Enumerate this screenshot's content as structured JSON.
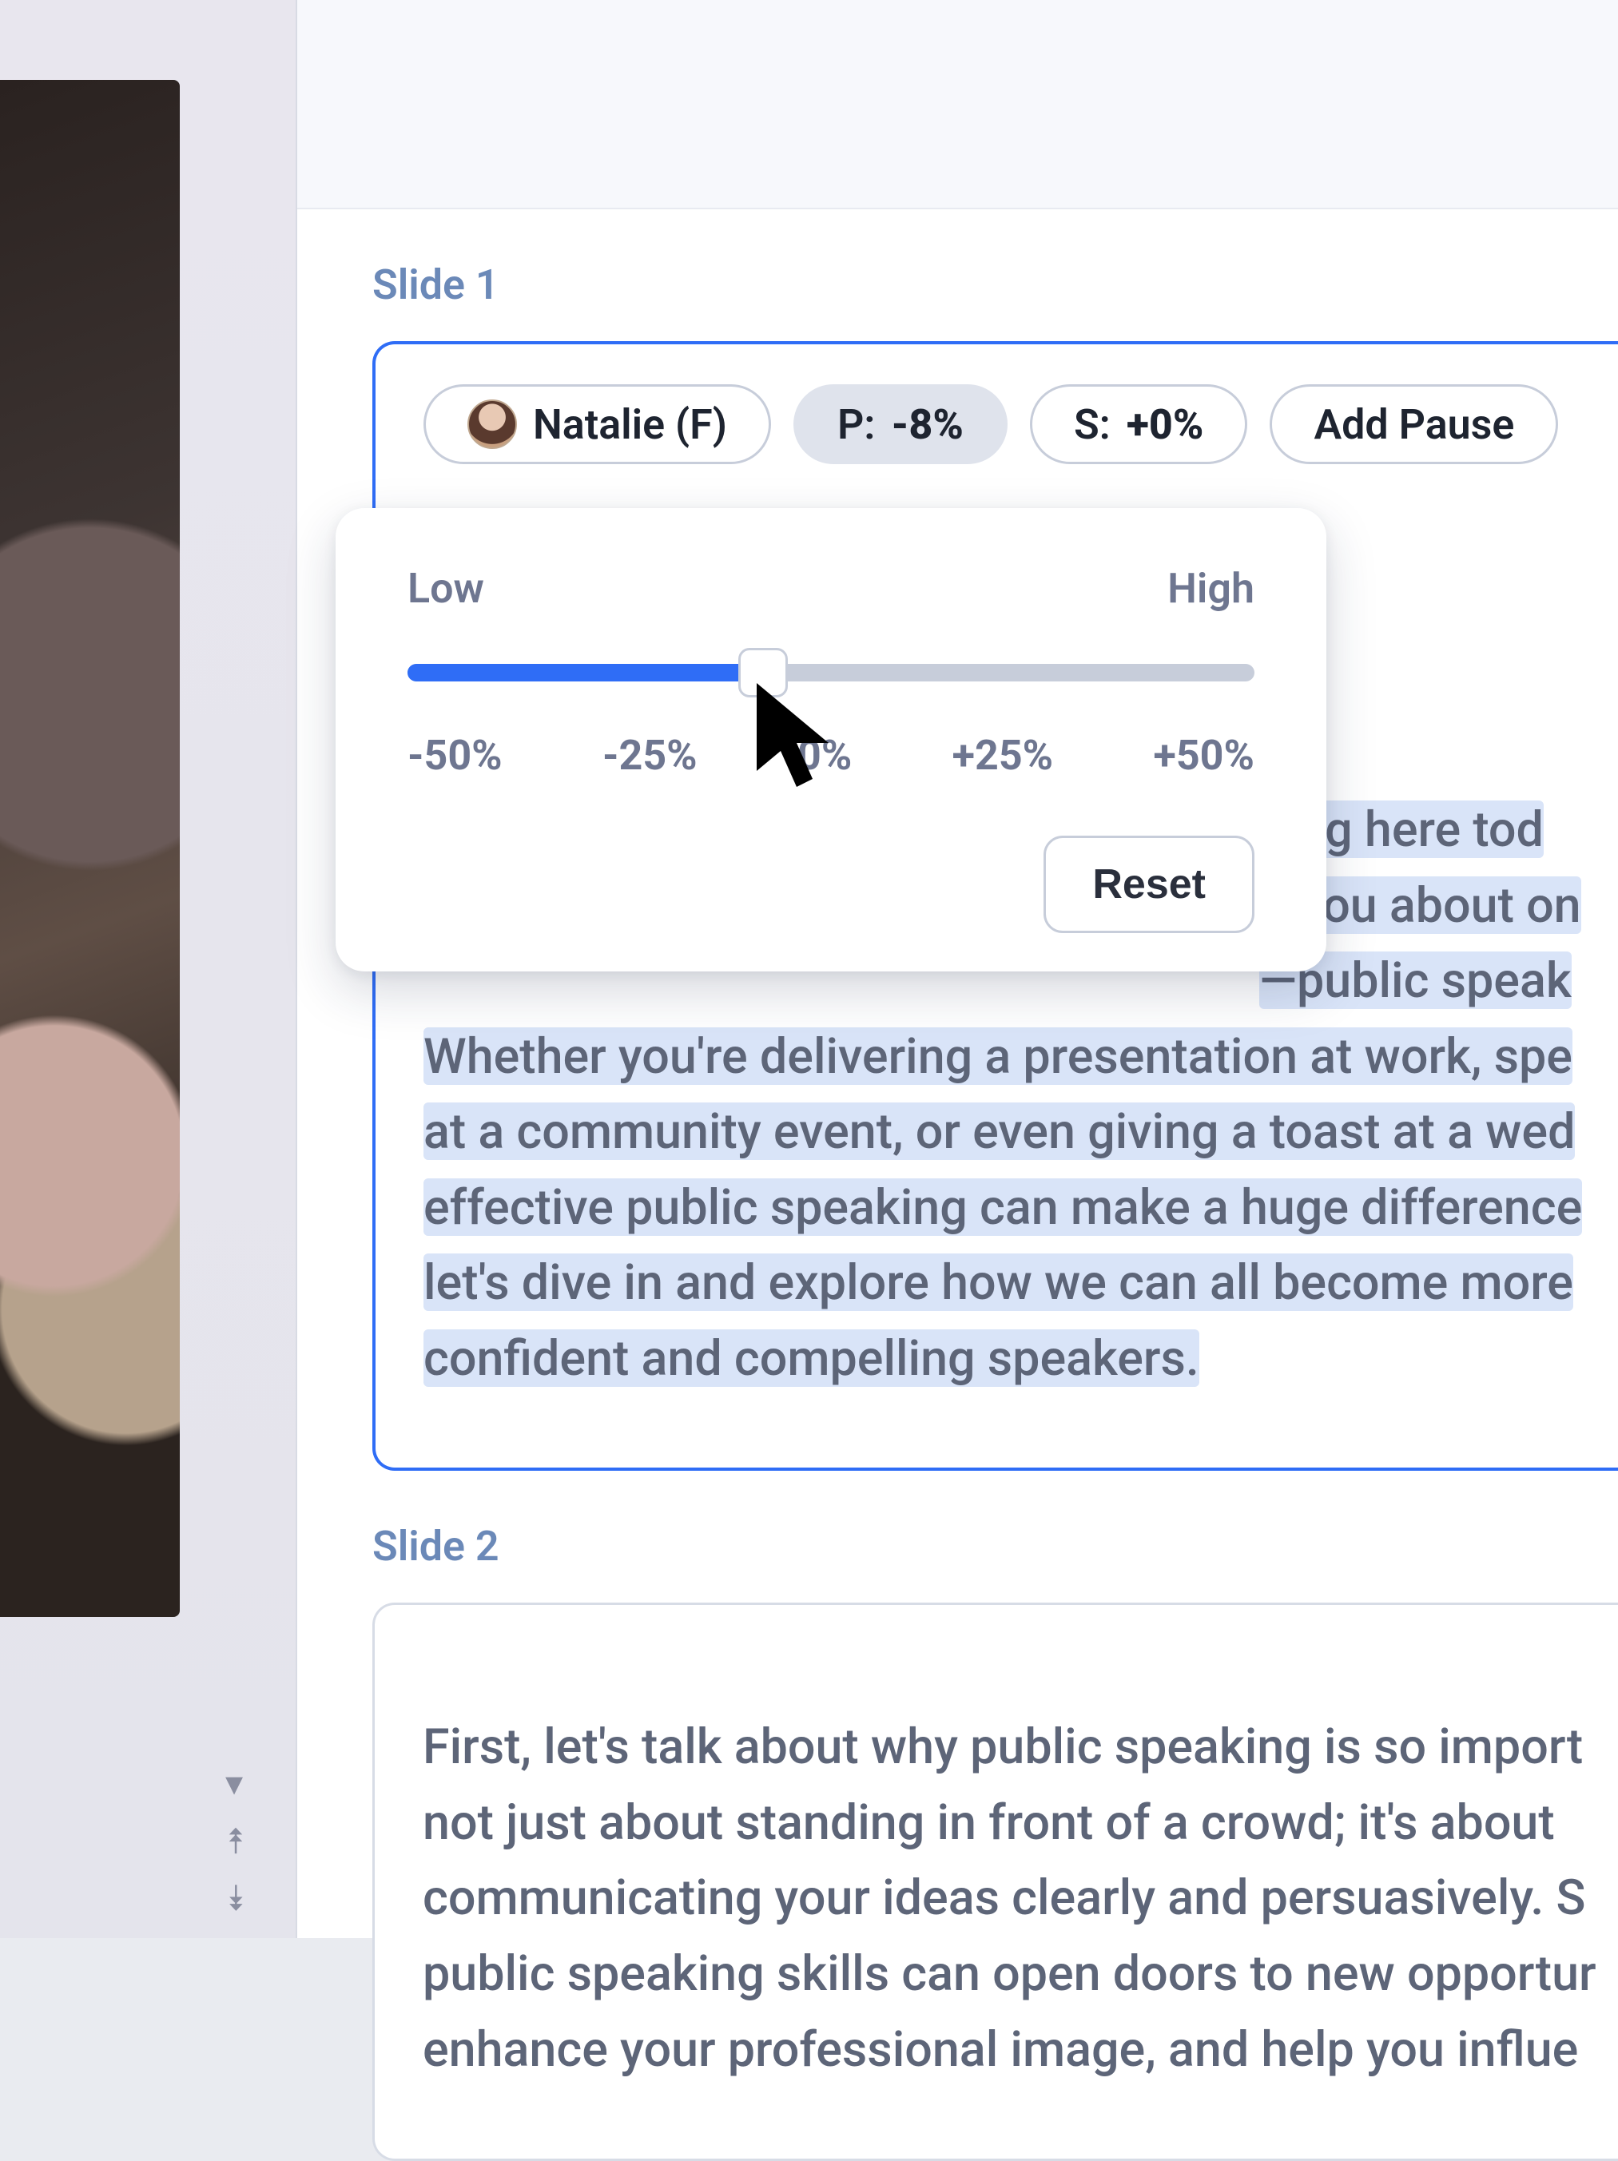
{
  "sidebar": {
    "arrows": {
      "down_small": "▾",
      "up_double": "⯭",
      "down_double": "⯯"
    }
  },
  "slide1": {
    "label": "Slide 1",
    "chips": {
      "voice_label": "Natalie (F)",
      "pitch_prefix": "P: ",
      "pitch_value": "-8%",
      "speed_prefix": "S: ",
      "speed_value": "+0%",
      "add_pause": "Add Pause"
    },
    "text_lines": [
      "eing here tod",
      "o you about on",
      "—public speak",
      "Whether you're delivering a presentation at work, spe",
      "at a community event, or even giving a toast at a wed",
      "effective public speaking can make a huge difference",
      "let's dive in and explore how we can all become more ",
      "confident and compelling speakers."
    ]
  },
  "popover": {
    "low": "Low",
    "high": "High",
    "ticks": [
      "-50%",
      "-25%",
      "0%",
      "+25%",
      "+50%"
    ],
    "slider_percent": 42,
    "reset": "Reset"
  },
  "slide2": {
    "label": "Slide 2",
    "text_lines": [
      "First, let's talk about why public speaking is so import",
      "not just about standing in front of a crowd; it's about ",
      "communicating your ideas clearly and persuasively. S",
      "public speaking skills can open doors to new opportur",
      "enhance your professional image, and help you influe"
    ]
  }
}
